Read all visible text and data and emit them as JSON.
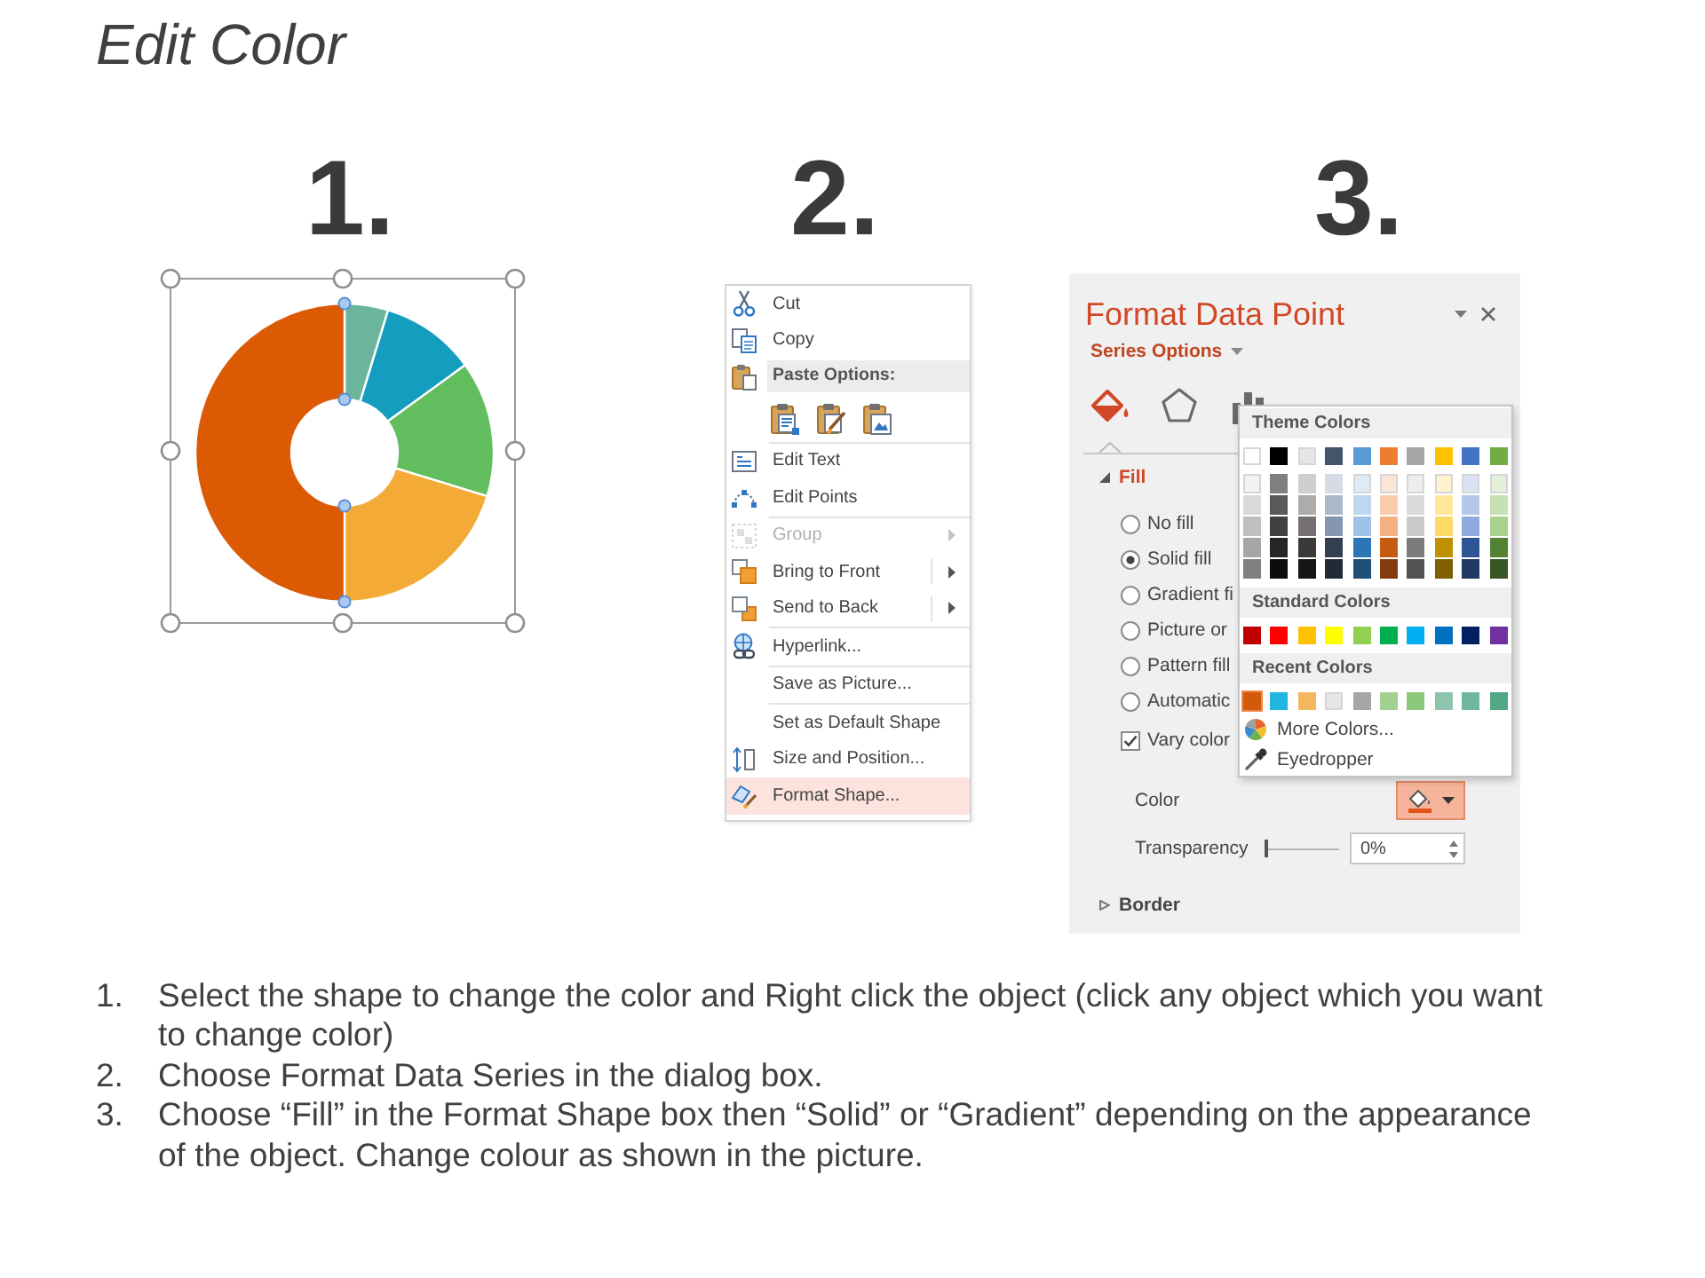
{
  "title": "Edit Color",
  "steps": [
    {
      "number": "1.",
      "kind": "donut",
      "donut_chart": {
        "selected": true
      }
    },
    {
      "number": "2.",
      "kind": "context_menu",
      "context_menu": {
        "groups": [
          {
            "items": [
              {
                "label": "Cut",
                "disabled": false,
                "selected": false,
                "submenu": false
              },
              {
                "label": "Copy",
                "disabled": false,
                "selected": false,
                "submenu": false
              }
            ],
            "paste_options": {
              "label": "Paste Options:"
            }
          },
          {
            "items": [
              {
                "label": "Edit Text",
                "disabled": false,
                "selected": false,
                "submenu": false
              },
              {
                "label": "Edit Points",
                "disabled": false,
                "selected": false,
                "submenu": false
              }
            ]
          },
          {
            "items": [
              {
                "label": "Group",
                "disabled": true,
                "selected": false,
                "submenu": true
              },
              {
                "label": "Bring to Front",
                "disabled": false,
                "selected": false,
                "submenu": true
              },
              {
                "label": "Send to Back",
                "disabled": false,
                "selected": false,
                "submenu": true
              }
            ]
          },
          {
            "items": [
              {
                "label": "Hyperlink...",
                "disabled": false,
                "selected": false,
                "submenu": false
              }
            ]
          },
          {
            "items": [
              {
                "label": "Save as Picture...",
                "disabled": false,
                "selected": false,
                "submenu": false
              }
            ]
          },
          {
            "items": [
              {
                "label": "Set as Default Shape",
                "disabled": false,
                "selected": false,
                "submenu": false
              },
              {
                "label": "Size and Position...",
                "disabled": false,
                "selected": false,
                "submenu": false
              },
              {
                "label": "Format Shape...",
                "disabled": false,
                "selected": true,
                "submenu": false
              }
            ]
          }
        ]
      }
    },
    {
      "number": "3.",
      "kind": "format_pane",
      "format_pane": {
        "title": "Format Data Point",
        "options_menu": "Series Options",
        "tabs": [
          {
            "selected": true
          },
          {
            "selected": false
          },
          {
            "selected": false
          }
        ],
        "fill": {
          "label": "Fill",
          "expanded": true,
          "options": [
            {
              "kind": "radio",
              "label": "No fill",
              "selected": false
            },
            {
              "kind": "radio",
              "label": "Solid fill",
              "selected": true
            },
            {
              "kind": "radio",
              "label": "Gradient fi",
              "selected": false
            },
            {
              "kind": "radio",
              "label": "Picture or",
              "selected": false
            },
            {
              "kind": "radio",
              "label": "Pattern fill",
              "selected": false
            },
            {
              "kind": "radio",
              "label": "Automatic",
              "selected": false
            },
            {
              "kind": "checkbox",
              "label": "Vary color",
              "checked": true
            }
          ],
          "color_label": "Color",
          "transparency": {
            "label": "Transparency",
            "level": 0,
            "value": "0%"
          }
        },
        "border": {
          "label": "Border",
          "expanded": false
        },
        "color_picker": {
          "theme_title": "Theme Colors",
          "theme_colors": [
            {
              "color": "#ffffff",
              "selected": false,
              "shades": [
                {
                  "color": "#f2f2f2",
                  "selected": false
                },
                {
                  "color": "#d9d9d9",
                  "selected": false
                },
                {
                  "color": "#bfbfbf",
                  "selected": false
                },
                {
                  "color": "#a6a6a6",
                  "selected": false
                },
                {
                  "color": "#808080",
                  "selected": false
                }
              ]
            },
            {
              "color": "#000000",
              "selected": false,
              "shades": [
                {
                  "color": "#7f7f7f",
                  "selected": false
                },
                {
                  "color": "#595959",
                  "selected": false
                },
                {
                  "color": "#404040",
                  "selected": false
                },
                {
                  "color": "#262626",
                  "selected": false
                },
                {
                  "color": "#0d0d0d",
                  "selected": false
                }
              ]
            },
            {
              "color": "#e7e6e6",
              "selected": false,
              "shades": [
                {
                  "color": "#d0cece",
                  "selected": false
                },
                {
                  "color": "#aeabab",
                  "selected": false
                },
                {
                  "color": "#757070",
                  "selected": false
                },
                {
                  "color": "#3a3838",
                  "selected": false
                },
                {
                  "color": "#171616",
                  "selected": false
                }
              ]
            },
            {
              "color": "#44546a",
              "selected": false,
              "shades": [
                {
                  "color": "#d6dce5",
                  "selected": false
                },
                {
                  "color": "#adb9ca",
                  "selected": false
                },
                {
                  "color": "#8497b0",
                  "selected": false
                },
                {
                  "color": "#333f50",
                  "selected": false
                },
                {
                  "color": "#222a35",
                  "selected": false
                }
              ]
            },
            {
              "color": "#5b9bd5",
              "selected": false,
              "shades": [
                {
                  "color": "#deebf7",
                  "selected": false
                },
                {
                  "color": "#bdd7ee",
                  "selected": false
                },
                {
                  "color": "#9dc3e6",
                  "selected": false
                },
                {
                  "color": "#2e75b6",
                  "selected": false
                },
                {
                  "color": "#1f4e79",
                  "selected": false
                }
              ]
            },
            {
              "color": "#ed7d31",
              "selected": false,
              "shades": [
                {
                  "color": "#fbe5d6",
                  "selected": false
                },
                {
                  "color": "#f8cbad",
                  "selected": false
                },
                {
                  "color": "#f4b183",
                  "selected": false
                },
                {
                  "color": "#c55a11",
                  "selected": false
                },
                {
                  "color": "#843c0c",
                  "selected": false
                }
              ]
            },
            {
              "color": "#a5a5a5",
              "selected": false,
              "shades": [
                {
                  "color": "#ededed",
                  "selected": false
                },
                {
                  "color": "#dbdbdb",
                  "selected": false
                },
                {
                  "color": "#c9c9c9",
                  "selected": false
                },
                {
                  "color": "#7b7b7b",
                  "selected": false
                },
                {
                  "color": "#525252",
                  "selected": false
                }
              ]
            },
            {
              "color": "#ffc000",
              "selected": false,
              "shades": [
                {
                  "color": "#fff2cc",
                  "selected": false
                },
                {
                  "color": "#ffe699",
                  "selected": false
                },
                {
                  "color": "#ffd966",
                  "selected": false
                },
                {
                  "color": "#bf9000",
                  "selected": false
                },
                {
                  "color": "#7f6000",
                  "selected": false
                }
              ]
            },
            {
              "color": "#4472c4",
              "selected": false,
              "shades": [
                {
                  "color": "#dae3f3",
                  "selected": false
                },
                {
                  "color": "#b4c7e7",
                  "selected": false
                },
                {
                  "color": "#8faadc",
                  "selected": false
                },
                {
                  "color": "#2f5597",
                  "selected": false
                },
                {
                  "color": "#203864",
                  "selected": false
                }
              ]
            },
            {
              "color": "#70ad47",
              "selected": false,
              "shades": [
                {
                  "color": "#e2f0d9",
                  "selected": false
                },
                {
                  "color": "#c5e0b4",
                  "selected": false
                },
                {
                  "color": "#a9d18e",
                  "selected": false
                },
                {
                  "color": "#548235",
                  "selected": false
                },
                {
                  "color": "#385723",
                  "selected": false
                }
              ]
            }
          ],
          "standard_title": "Standard Colors",
          "standard_colors": [
            {
              "color": "#c00000",
              "selected": false
            },
            {
              "color": "#ff0000",
              "selected": false
            },
            {
              "color": "#ffc000",
              "selected": false
            },
            {
              "color": "#ffff00",
              "selected": false
            },
            {
              "color": "#92d050",
              "selected": false
            },
            {
              "color": "#00b050",
              "selected": false
            },
            {
              "color": "#00b0f0",
              "selected": false
            },
            {
              "color": "#0070c0",
              "selected": false
            },
            {
              "color": "#002060",
              "selected": false
            },
            {
              "color": "#7030a0",
              "selected": false
            }
          ],
          "recent_title": "Recent Colors",
          "recent_colors": [
            {
              "color": "#d45a0b",
              "selected": true
            },
            {
              "color": "#22b5e2",
              "selected": false
            },
            {
              "color": "#f3b75e",
              "selected": false
            },
            {
              "color": "#e6e6e6",
              "selected": false
            },
            {
              "color": "#a6a6a6",
              "selected": false
            },
            {
              "color": "#a3d18f",
              "selected": false
            },
            {
              "color": "#8cc77c",
              "selected": false
            },
            {
              "color": "#8dc4ae",
              "selected": false
            },
            {
              "color": "#6fb89c",
              "selected": false
            },
            {
              "color": "#52a786",
              "selected": false
            }
          ],
          "more_colors": "More Colors...",
          "eyedropper": "Eyedropper"
        }
      }
    }
  ],
  "instructions": [
    {
      "number": "1.",
      "text": "Select the shape to change the color and Right click the object (click any object which you want to change color)"
    },
    {
      "number": "2.",
      "text": "Choose Format Data Series in the dialog box."
    },
    {
      "number": "3.",
      "text": "Choose “Fill” in the Format Shape box then “Solid” or “Gradient” depending on the appearance of the object. Change colour as shown in the picture."
    }
  ]
}
